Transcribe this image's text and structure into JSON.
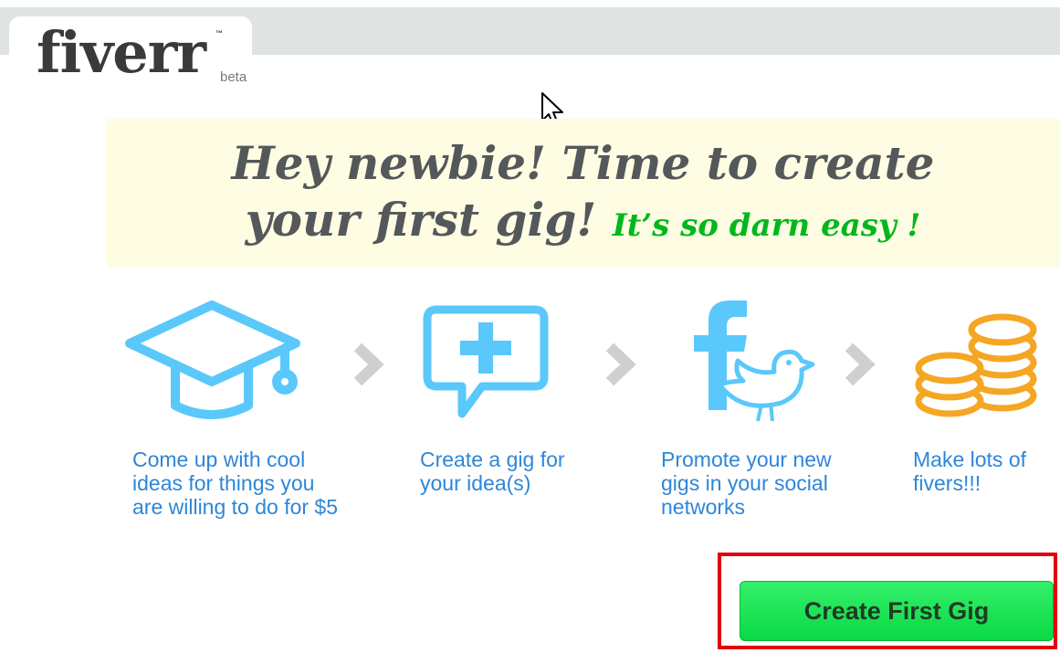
{
  "logo": {
    "wordmark": "fiverr",
    "trademark": "™",
    "beta": "beta"
  },
  "banner": {
    "line1": "Hey newbie! Time to create",
    "line2_main": "your first gig!",
    "line2_accent": "It’s so darn easy !"
  },
  "steps": [
    {
      "icon": "graduation-cap-icon",
      "text": "Come up with cool\nideas for things you\nare willing to do for $5"
    },
    {
      "icon": "speech-bubble-plus-icon",
      "text": "Create a gig for\nyour idea(s)"
    },
    {
      "icon": "facebook-twitter-icon",
      "text": "Promote your new\ngigs in your social\nnetworks"
    },
    {
      "icon": "coins-stack-icon",
      "text": "Make lots of\nfivers!!!"
    }
  ],
  "cta": {
    "label": "Create First Gig"
  },
  "colors": {
    "step_text": "#2e86d8",
    "icon_blue": "#5ac8fa",
    "icon_orange": "#f5a623",
    "cta_green": "#09d944",
    "banner_accent": "#00b81b",
    "highlight_red": "#e3000f"
  }
}
